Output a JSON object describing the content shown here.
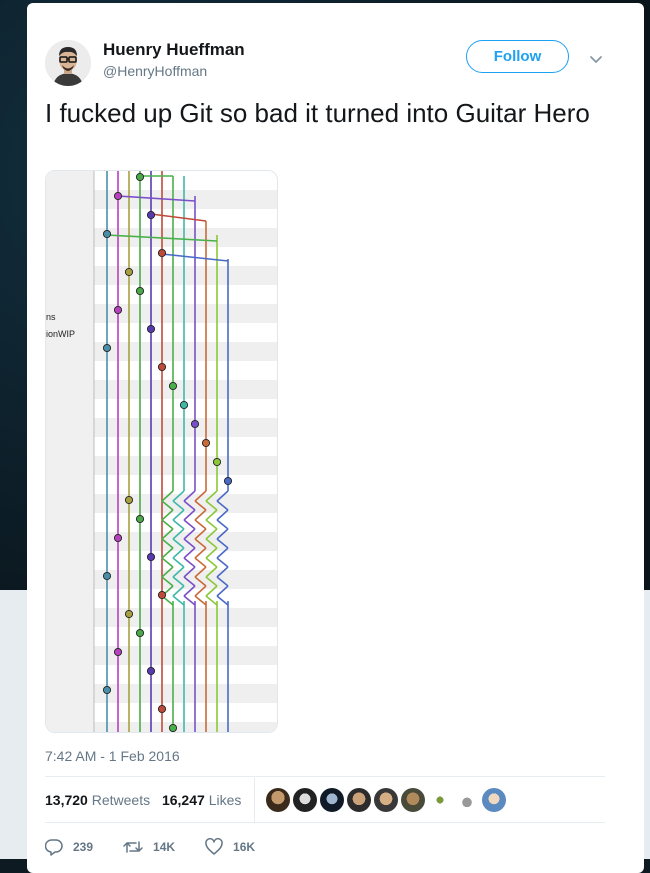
{
  "author": {
    "name": "Huenry Hueffman",
    "handle": "@HenryHoffman"
  },
  "follow_label": "Follow",
  "tweet_text": "I fucked up Git so bad it turned into Guitar Hero",
  "image": {
    "sidebar_labels": [
      "ns",
      "ionWIP"
    ]
  },
  "timestamp": "7:42 AM - 1 Feb 2016",
  "stats": {
    "retweets_count": "13,720",
    "retweets_label": "Retweets",
    "likes_count": "16,247",
    "likes_label": "Likes"
  },
  "likers": [
    "avatar-1",
    "avatar-2",
    "avatar-3",
    "avatar-4",
    "avatar-5",
    "avatar-6",
    "avatar-7",
    "avatar-8",
    "avatar-9"
  ],
  "actions": {
    "reply_count": "239",
    "retweet_count": "14K",
    "like_count": "16K"
  },
  "colors": {
    "accent": "#1da1f2",
    "text": "#14171a",
    "muted": "#657786"
  },
  "icons": [
    "caret-down-icon",
    "reply-icon",
    "retweet-icon",
    "heart-icon"
  ]
}
